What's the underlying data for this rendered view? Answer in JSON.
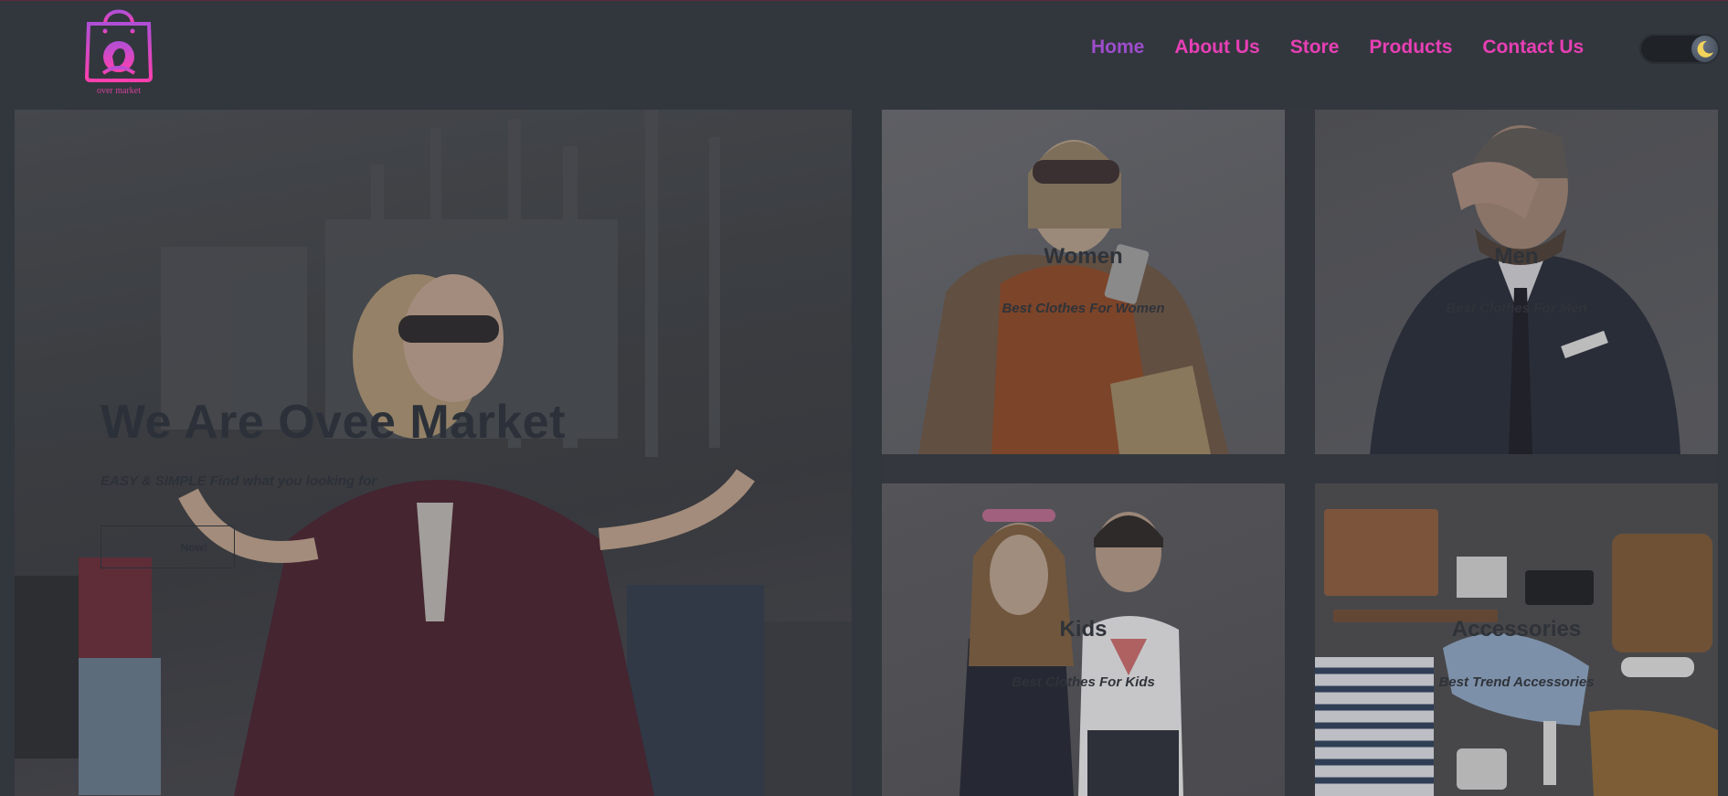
{
  "brand": {
    "logo_text": "over market",
    "colors": {
      "accent": "#e83fb5",
      "active": "#9d4dcc",
      "background": "#32373d"
    }
  },
  "nav": {
    "items": [
      {
        "label": "Home",
        "active": true
      },
      {
        "label": "About Us",
        "active": false
      },
      {
        "label": "Store",
        "active": false
      },
      {
        "label": "Products",
        "active": false
      },
      {
        "label": "Contact Us",
        "active": false
      }
    ]
  },
  "theme_toggle": {
    "icon": "moon-icon",
    "state": "dark"
  },
  "hero": {
    "title": "We Are Ovee Market",
    "subtitle": "EASY & SIMPLE Find what you looking for",
    "button_label": "Now!"
  },
  "categories": [
    {
      "title": "Women",
      "subtitle": "Best Clothes For Women"
    },
    {
      "title": "Men",
      "subtitle": "Best Clothes For Men"
    },
    {
      "title": "Kids",
      "subtitle": "Best Clothes For Kids"
    },
    {
      "title": "Accessories",
      "subtitle": "Best Trend Accessories"
    }
  ]
}
